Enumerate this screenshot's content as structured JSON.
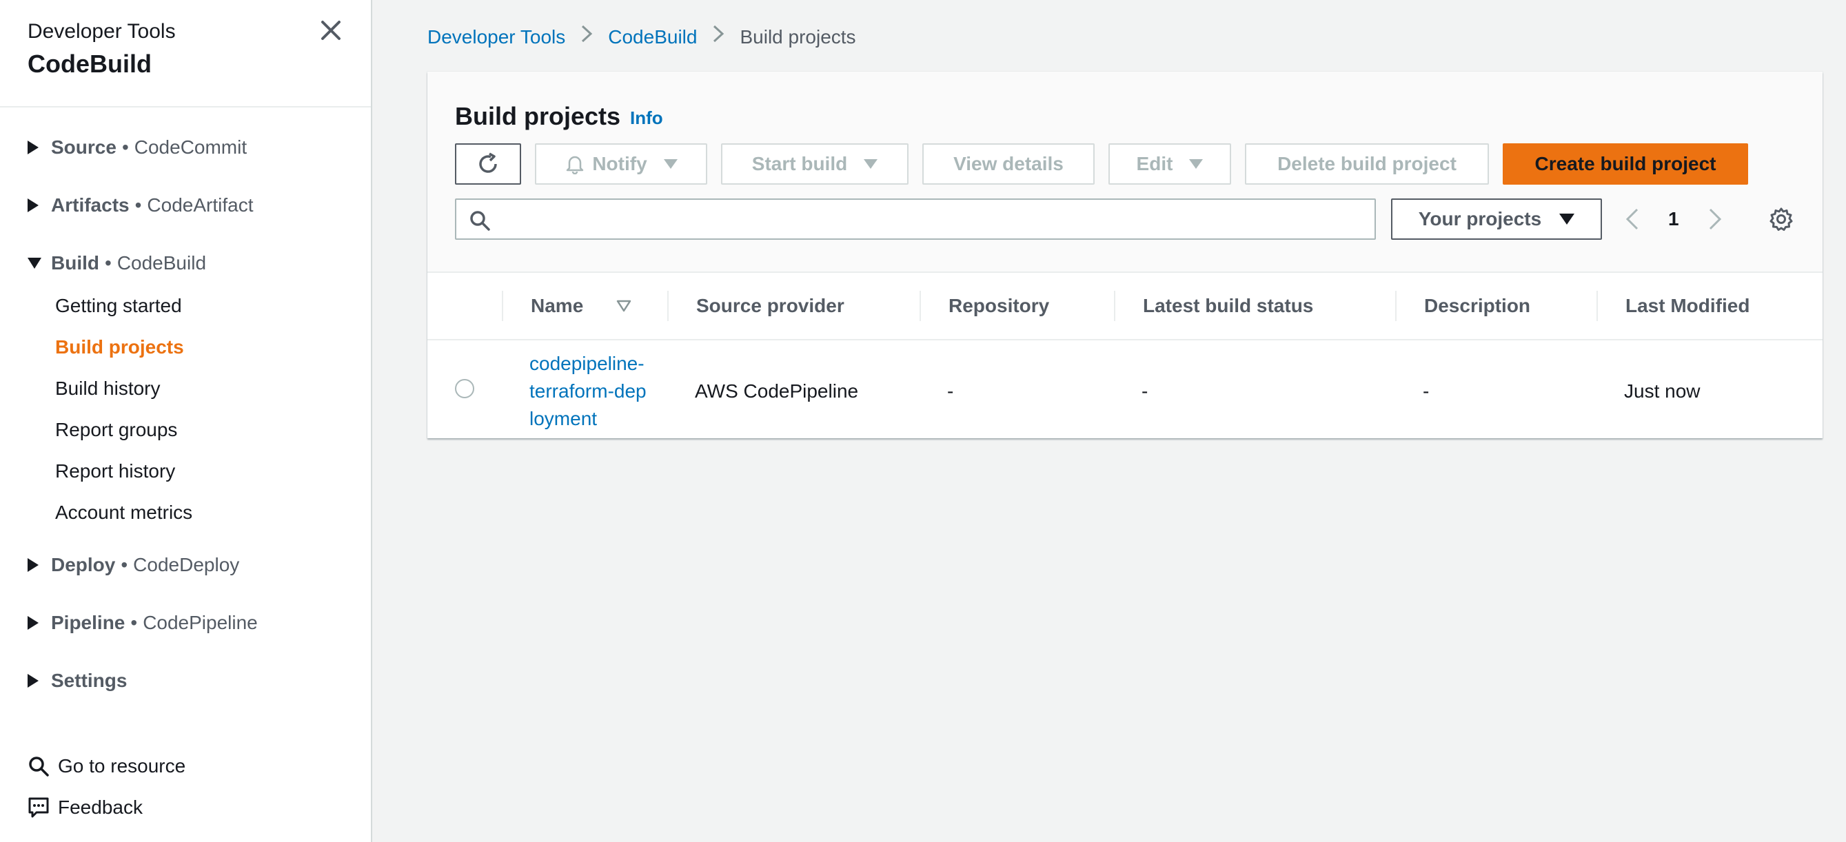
{
  "sidebar": {
    "super_title": "Developer Tools",
    "title": "CodeBuild",
    "sections": [
      {
        "label": "Source",
        "service": "CodeCommit"
      },
      {
        "label": "Artifacts",
        "service": "CodeArtifact"
      },
      {
        "label": "Build",
        "service": "CodeBuild"
      },
      {
        "label": "Deploy",
        "service": "CodeDeploy"
      },
      {
        "label": "Pipeline",
        "service": "CodePipeline"
      },
      {
        "label": "Settings",
        "service": ""
      }
    ],
    "dot": "•",
    "build_items": [
      {
        "label": "Getting started"
      },
      {
        "label": "Build projects"
      },
      {
        "label": "Build history"
      },
      {
        "label": "Report groups"
      },
      {
        "label": "Report history"
      },
      {
        "label": "Account metrics"
      }
    ],
    "go_to_resource": "Go to resource",
    "feedback": "Feedback"
  },
  "breadcrumb": {
    "items": [
      "Developer Tools",
      "CodeBuild"
    ],
    "current": "Build projects"
  },
  "panel": {
    "title": "Build projects",
    "info": "Info",
    "buttons": {
      "notify": "Notify",
      "start_build": "Start build",
      "view_details": "View details",
      "edit": "Edit",
      "delete": "Delete build project",
      "create": "Create build project"
    },
    "search": {
      "value": "",
      "placeholder": ""
    },
    "filter_select": "Your projects",
    "page": "1"
  },
  "table": {
    "columns": [
      "Name",
      "Source provider",
      "Repository",
      "Latest build status",
      "Description",
      "Last Modified"
    ],
    "rows": [
      {
        "name": "codepipeline-terraform-deployment",
        "source_provider": "AWS CodePipeline",
        "repository": "-",
        "latest_build_status": "-",
        "description": "-",
        "last_modified": "Just now"
      }
    ]
  },
  "colors": {
    "accent_orange": "#ec7211",
    "link_blue": "#0073bb",
    "disabled_gray": "#aab7b8"
  }
}
